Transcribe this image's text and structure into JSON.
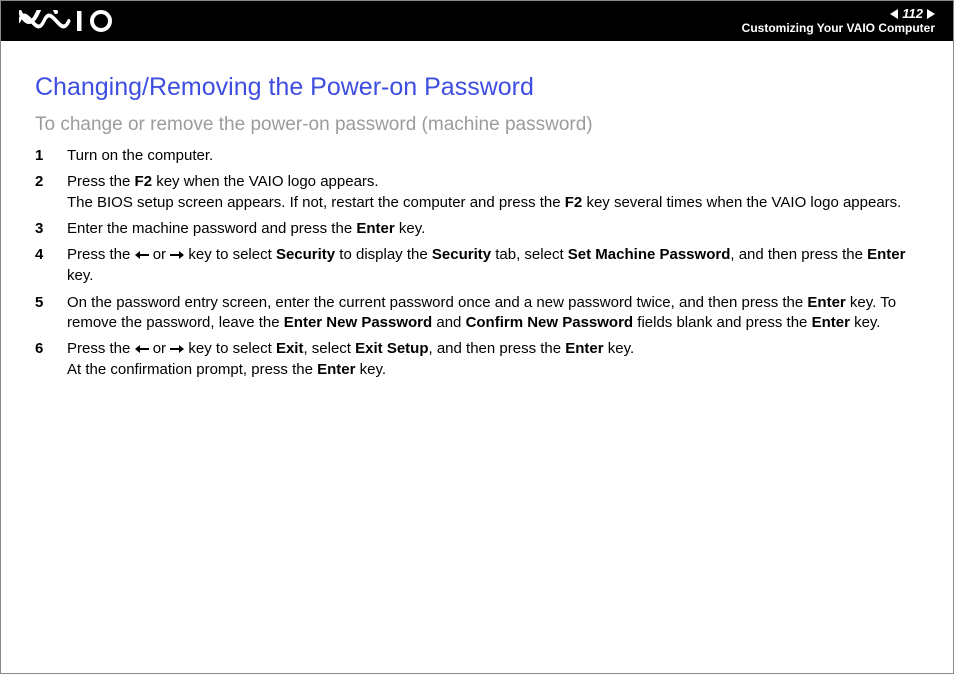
{
  "header": {
    "page_number": "112",
    "section": "Customizing Your VAIO Computer"
  },
  "title": "Changing/Removing the Power-on Password",
  "subtitle": "To change or remove the power-on password (machine password)",
  "steps": {
    "s1": "Turn on the computer.",
    "s2a": "Press the ",
    "s2b": "F2",
    "s2c": " key when the VAIO logo appears.",
    "s2d": "The BIOS setup screen appears. If not, restart the computer and press the ",
    "s2e": "F2",
    "s2f": " key several times when the VAIO logo appears.",
    "s3a": "Enter the machine password and press the ",
    "s3b": "Enter",
    "s3c": " key.",
    "s4a": "Press the ",
    "s4b": " or ",
    "s4c": " key to select ",
    "s4d": "Security",
    "s4e": " to display the ",
    "s4f": "Security",
    "s4g": " tab, select ",
    "s4h": "Set Machine Password",
    "s4i": ", and then press the ",
    "s4j": "Enter",
    "s4k": " key.",
    "s5a": "On the password entry screen, enter the current password once and a new password twice, and then press the ",
    "s5b": "Enter",
    "s5c": " key. To remove the password, leave the ",
    "s5d": "Enter New Password",
    "s5e": " and ",
    "s5f": "Confirm New Password",
    "s5g": " fields blank and press the ",
    "s5h": "Enter",
    "s5i": " key.",
    "s6a": "Press the ",
    "s6b": " or ",
    "s6c": " key to select ",
    "s6d": "Exit",
    "s6e": ", select ",
    "s6f": "Exit Setup",
    "s6g": ", and then press the ",
    "s6h": "Enter",
    "s6i": " key.",
    "s6j": "At the confirmation prompt, press the ",
    "s6k": "Enter",
    "s6l": " key."
  }
}
